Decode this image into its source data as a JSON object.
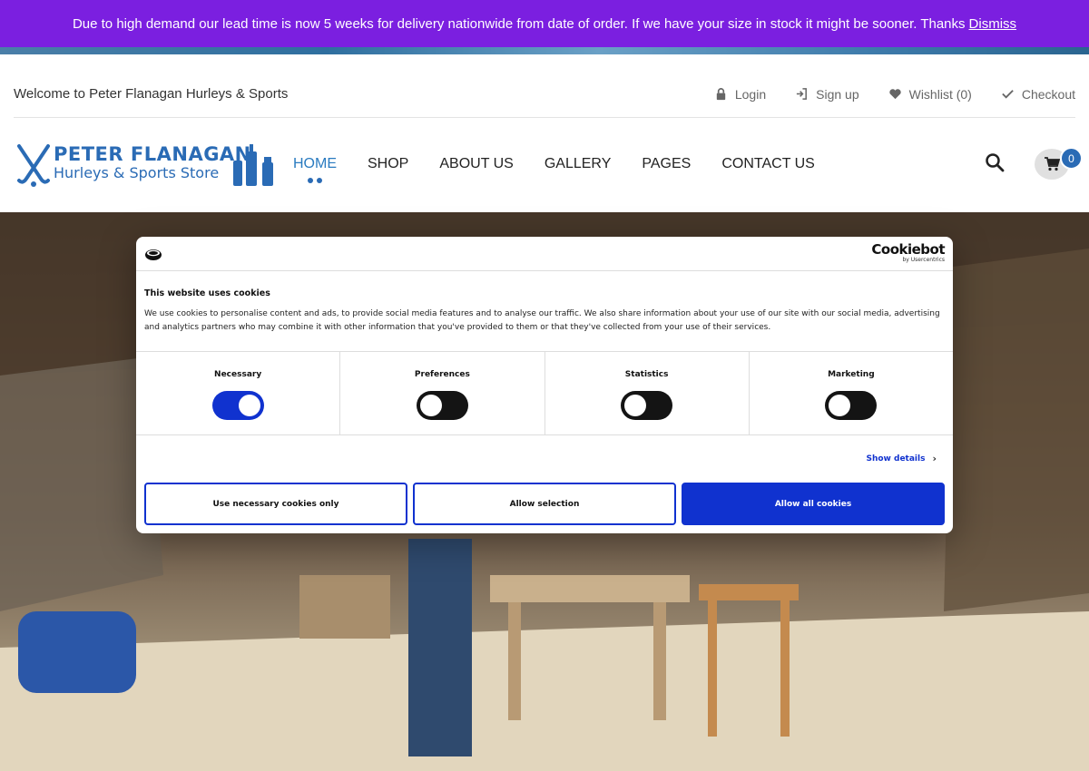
{
  "announcement": {
    "text": "Due to high demand our lead time is now 5 weeks for delivery nationwide from date of order. If we have your size in stock it might be sooner. Thanks",
    "dismiss_label": "Dismiss",
    "bg_color": "#7b1fe0"
  },
  "topbar": {
    "welcome": "Welcome to Peter Flanagan Hurleys & Sports",
    "links": [
      {
        "label": "Login",
        "icon": "lock-icon"
      },
      {
        "label": "Sign up",
        "icon": "sign-in-icon"
      },
      {
        "label": "Wishlist (0)",
        "icon": "heart-icon"
      },
      {
        "label": "Checkout",
        "icon": "check-icon"
      }
    ]
  },
  "header": {
    "logo_line1": "PETER FLANAGAN",
    "logo_line2": "Hurleys & Sports Store",
    "nav": [
      {
        "label": "HOME",
        "active": true
      },
      {
        "label": "SHOP"
      },
      {
        "label": "ABOUT US"
      },
      {
        "label": "GALLERY"
      },
      {
        "label": "PAGES"
      },
      {
        "label": "CONTACT US"
      }
    ],
    "cart_count": "0",
    "accent_color": "#2a6bb5"
  },
  "cookie": {
    "brand": "Cookiebot",
    "brand_sub": "by Usercentrics",
    "title": "This website uses cookies",
    "text": "We use cookies to personalise content and ads, to provide social media features and to analyse our traffic. We also share information about your use of our site with our social media, advertising and analytics partners who may combine it with other information that you've provided to them or that they've collected from your use of their services.",
    "toggles": [
      {
        "label": "Necessary",
        "on": true
      },
      {
        "label": "Preferences",
        "on": false
      },
      {
        "label": "Statistics",
        "on": false
      },
      {
        "label": "Marketing",
        "on": false
      }
    ],
    "show_details": "Show details",
    "buttons": {
      "necessary": "Use necessary cookies only",
      "selection": "Allow selection",
      "all": "Allow all cookies"
    },
    "accent_color": "#1032cf"
  }
}
